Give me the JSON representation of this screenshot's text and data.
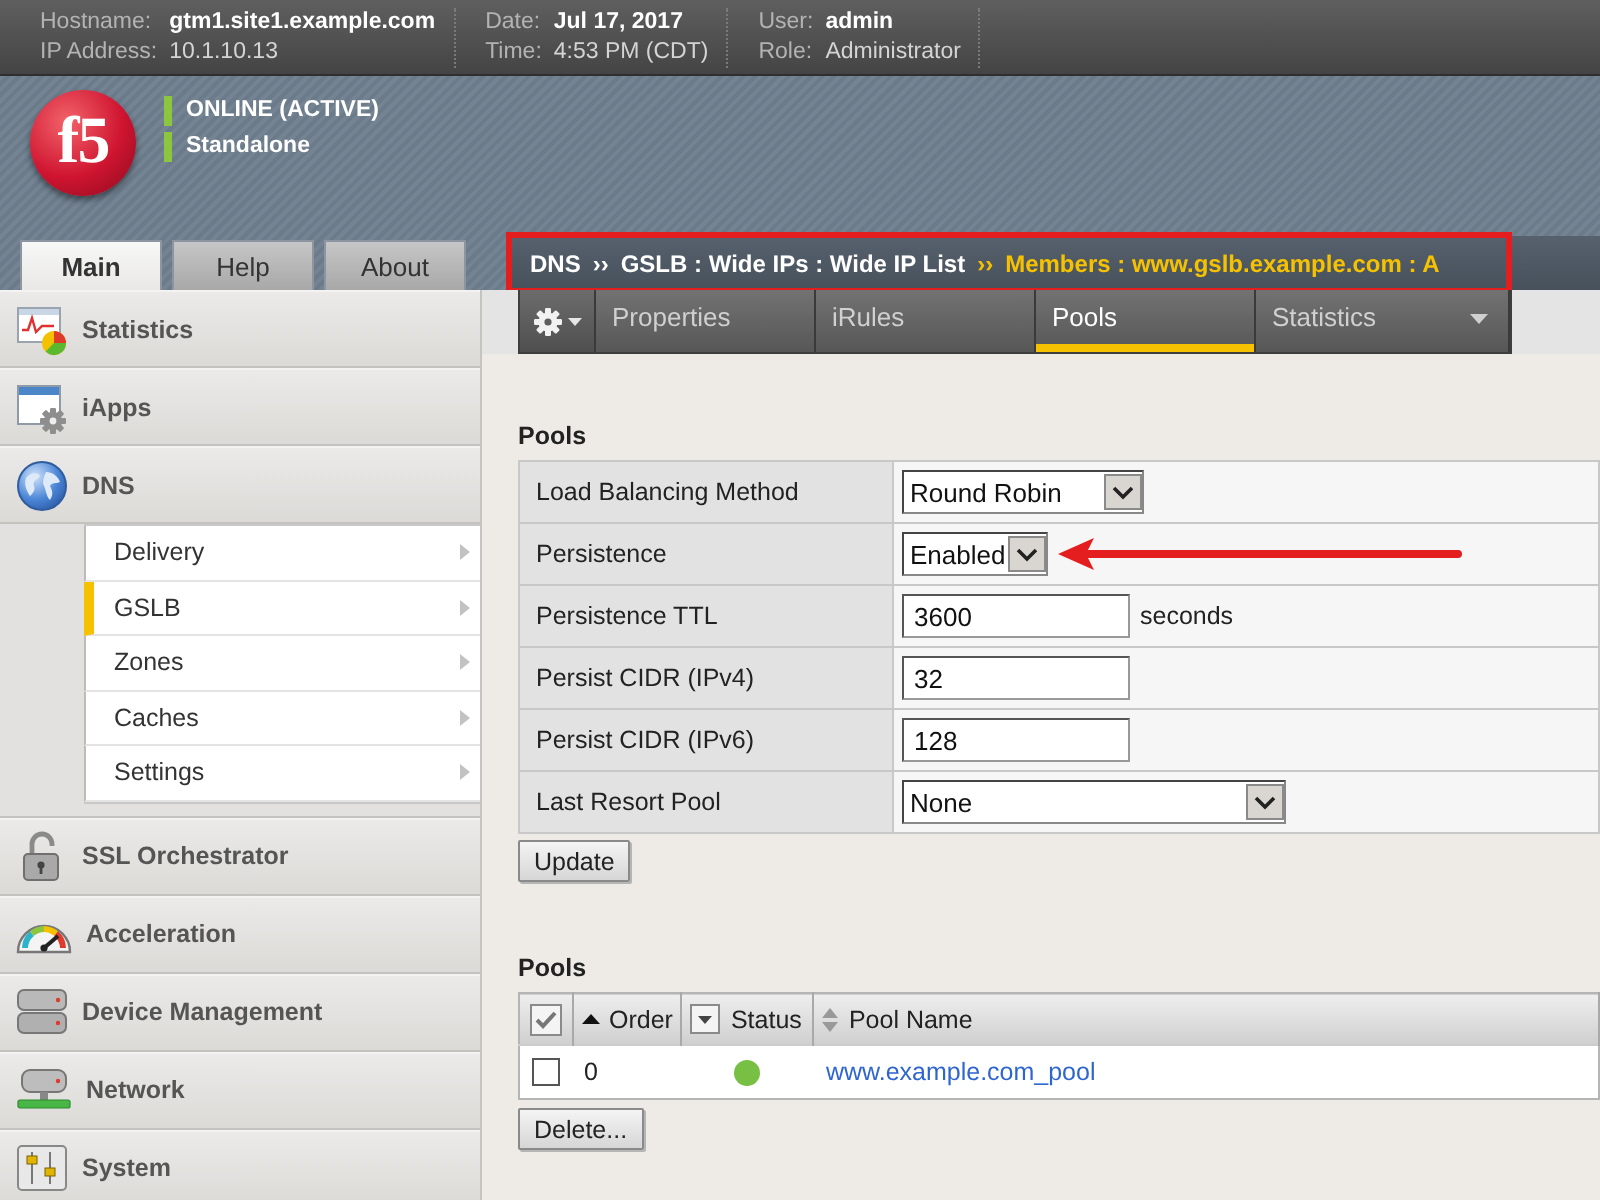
{
  "header": {
    "groups": [
      {
        "rows": [
          {
            "label": "Hostname:",
            "value": "gtm1.site1.example.com"
          },
          {
            "label": "IP Address:",
            "value": "10.1.10.13"
          }
        ]
      },
      {
        "rows": [
          {
            "label": "Date:",
            "value": "Jul 17, 2017"
          },
          {
            "label": "Time:",
            "value": "4:53 PM (CDT)"
          }
        ]
      },
      {
        "rows": [
          {
            "label": "User:",
            "value": "admin"
          },
          {
            "label": "Role:",
            "value": "Administrator"
          }
        ]
      }
    ]
  },
  "logo": {
    "text": "f5"
  },
  "status": [
    "ONLINE (ACTIVE)",
    "Standalone"
  ],
  "main_tabs": [
    {
      "label": "Main",
      "selected": true
    },
    {
      "label": "Help",
      "selected": false
    },
    {
      "label": "About",
      "selected": false
    }
  ],
  "breadcrumb": {
    "marked": true,
    "items": [
      {
        "text": "DNS",
        "current": false
      },
      {
        "separator": "››",
        "text": "GSLB : Wide IPs : Wide IP List",
        "current": false
      },
      {
        "separator": "››",
        "text": "Members : www.gslb.example.com : A",
        "current": true
      }
    ]
  },
  "section_tabs": [
    {
      "label": "Properties",
      "selected": false,
      "dropdown": false
    },
    {
      "label": "iRules",
      "selected": false,
      "dropdown": false
    },
    {
      "label": "Pools",
      "selected": true,
      "dropdown": false
    },
    {
      "label": "Statistics",
      "selected": false,
      "dropdown": true
    }
  ],
  "sidebar": {
    "items": [
      {
        "kind": "statistics",
        "label": "Statistics"
      },
      {
        "kind": "iapps",
        "label": "iApps"
      },
      {
        "kind": "dns",
        "label": "DNS",
        "children": [
          {
            "label": "Delivery",
            "selected": false
          },
          {
            "label": "GSLB",
            "selected": true
          },
          {
            "label": "Zones",
            "selected": false
          },
          {
            "label": "Caches",
            "selected": false
          },
          {
            "label": "Settings",
            "selected": false
          }
        ]
      },
      {
        "kind": "ssl",
        "label": "SSL Orchestrator"
      },
      {
        "kind": "acceleration",
        "label": "Acceleration"
      },
      {
        "kind": "device",
        "label": "Device Management"
      },
      {
        "kind": "network",
        "label": "Network"
      },
      {
        "kind": "system",
        "label": "System"
      }
    ]
  },
  "properties": {
    "title": "Pools",
    "rows": [
      {
        "label": "Load Balancing Method",
        "kind": "select",
        "value": "Round Robin",
        "marked": false
      },
      {
        "label": "Persistence",
        "kind": "select",
        "value": "Enabled",
        "marked": true
      },
      {
        "label": "Persistence TTL",
        "kind": "input",
        "value": "3600",
        "unit": "seconds",
        "marked": false
      },
      {
        "label": "Persist CIDR (IPv4)",
        "kind": "input",
        "value": "32",
        "marked": false
      },
      {
        "label": "Persist CIDR (IPv6)",
        "kind": "input",
        "value": "128",
        "marked": false
      },
      {
        "label": "Last Resort Pool",
        "kind": "select",
        "value": "None",
        "marked": false
      }
    ],
    "button": "Update"
  },
  "pools": {
    "title": "Pools",
    "columns": [
      {
        "kind": "select_all",
        "checked": true
      },
      {
        "kind": "sorted",
        "label": "Order"
      },
      {
        "kind": "filter",
        "label": "Status"
      },
      {
        "kind": "sortable",
        "label": "Pool Name"
      }
    ],
    "rows": [
      {
        "checked": false,
        "order": "0",
        "color": "#77c043",
        "name": "www.example.com_pool"
      }
    ],
    "button": "Delete..."
  }
}
